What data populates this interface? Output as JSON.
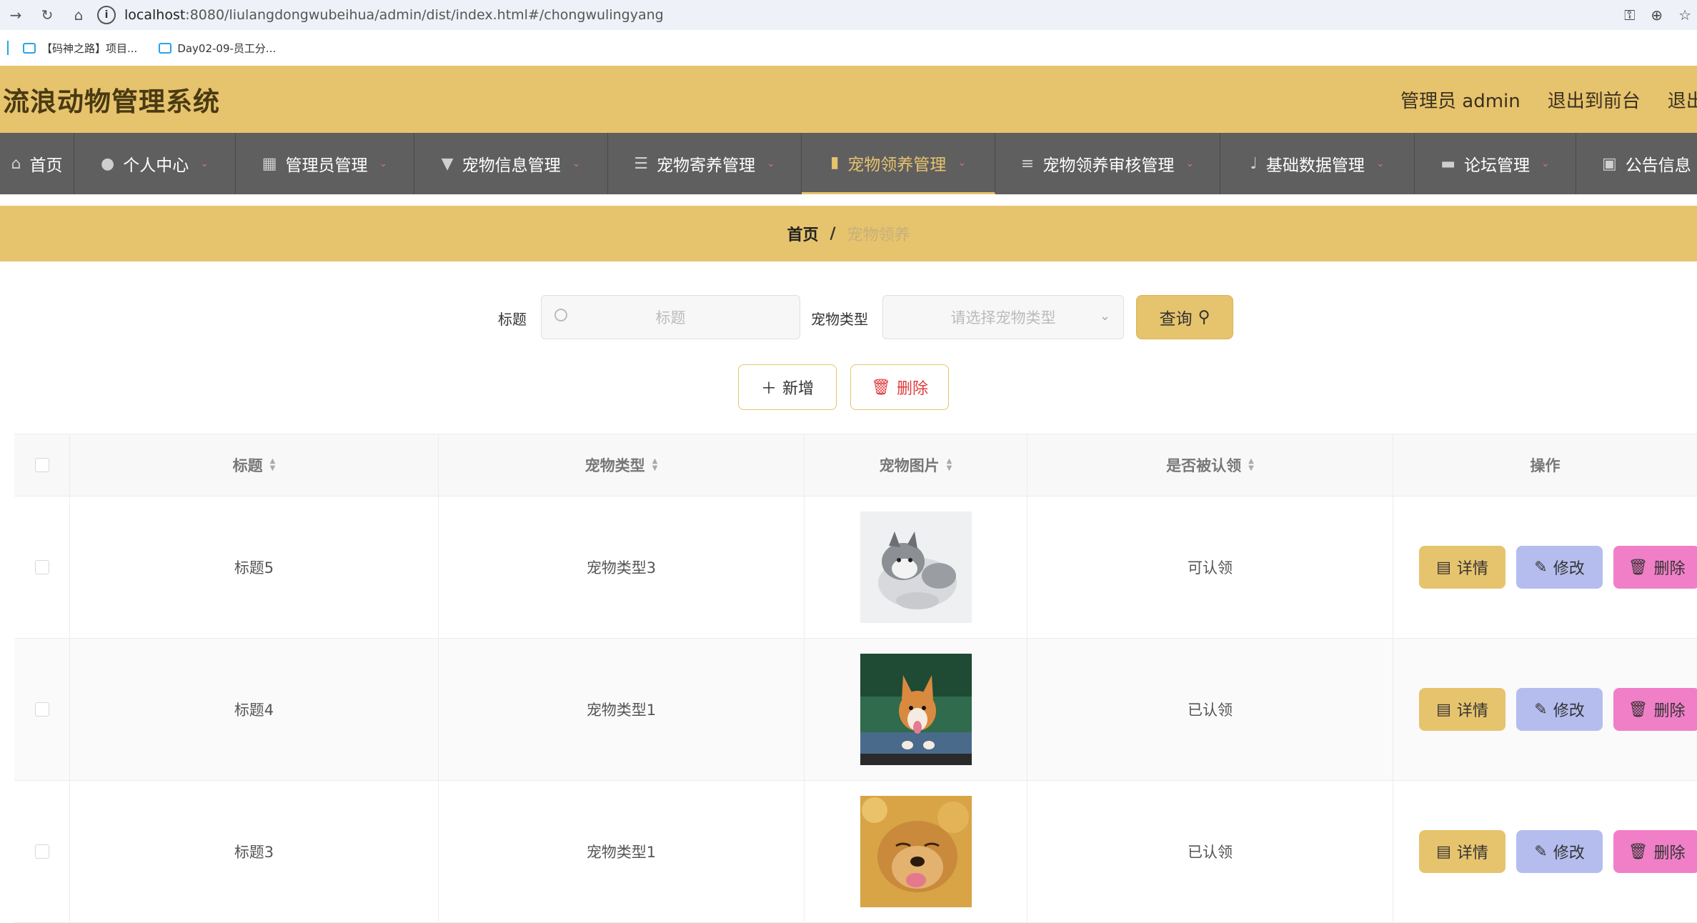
{
  "browser": {
    "url_host": "localhost",
    "url_rest": ":8080/liulangdongwubeihua/admin/dist/index.html#/chongwulingyang",
    "bookmarks": [
      "【码神之路】项目...",
      "Day02-09-员工分..."
    ]
  },
  "header": {
    "title": "流浪动物管理系统",
    "admin_label": "管理员 admin",
    "to_front": "退出到前台",
    "logout": "退出登录"
  },
  "nav": {
    "items": [
      {
        "label": "首页",
        "icon": "home-icon"
      },
      {
        "label": "个人中心",
        "icon": "user-icon"
      },
      {
        "label": "管理员管理",
        "icon": "grid-icon"
      },
      {
        "label": "宠物信息管理",
        "icon": "brush-icon"
      },
      {
        "label": "宠物寄养管理",
        "icon": "sliders-icon"
      },
      {
        "label": "宠物领养管理",
        "icon": "book-icon"
      },
      {
        "label": "宠物领养审核管理",
        "icon": "list-icon"
      },
      {
        "label": "基础数据管理",
        "icon": "mic-icon"
      },
      {
        "label": "论坛管理",
        "icon": "chat-icon"
      },
      {
        "label": "公告信息",
        "icon": "notice-icon"
      }
    ]
  },
  "breadcrumb": {
    "home": "首页",
    "sep": "/",
    "current": "宠物领养"
  },
  "search": {
    "title_label": "标题",
    "title_placeholder": "标题",
    "type_label": "宠物类型",
    "type_placeholder": "请选择宠物类型",
    "query_button": "查询"
  },
  "actions": {
    "add": "新增",
    "delete": "删除"
  },
  "table": {
    "headers": {
      "title": "标题",
      "type": "宠物类型",
      "image": "宠物图片",
      "recognized": "是否被认领",
      "ops": "操作"
    },
    "rows": [
      {
        "title": "标题5",
        "type": "宠物类型3",
        "image": "husky-puppy-photo",
        "recognized": "可认领"
      },
      {
        "title": "标题4",
        "type": "宠物类型1",
        "image": "corgi-photo",
        "recognized": "已认领"
      },
      {
        "title": "标题3",
        "type": "宠物类型1",
        "image": "golden-retriever-photo",
        "recognized": "已认领"
      }
    ],
    "op_labels": {
      "detail": "详情",
      "edit": "修改",
      "delete": "删除"
    }
  },
  "colors": {
    "accent": "#e6c36d",
    "nav_bg": "#5f5f5f",
    "edit_button": "#b4bdee",
    "delete_button": "#f07fc7"
  }
}
